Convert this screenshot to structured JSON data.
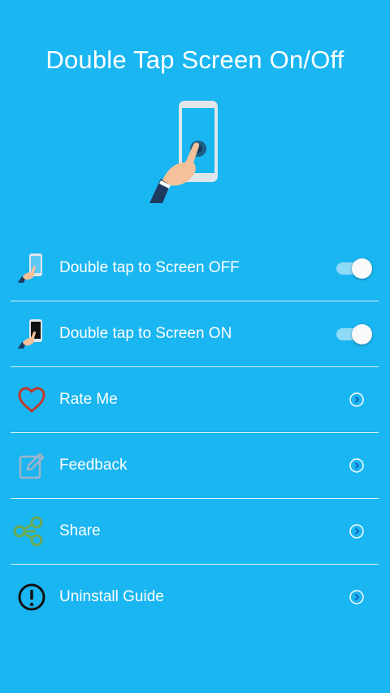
{
  "app": {
    "title": "Double Tap Screen On/Off"
  },
  "menu": {
    "items": [
      {
        "label": "Double tap to Screen OFF",
        "icon": "hand-phone-off-icon",
        "control": "toggle",
        "checked": true
      },
      {
        "label": "Double tap to Screen ON",
        "icon": "hand-phone-on-icon",
        "control": "toggle",
        "checked": true
      },
      {
        "label": "Rate Me",
        "icon": "heart-icon",
        "control": "chevron"
      },
      {
        "label": "Feedback",
        "icon": "edit-icon",
        "control": "chevron"
      },
      {
        "label": "Share",
        "icon": "share-icon",
        "control": "chevron"
      },
      {
        "label": "Uninstall Guide",
        "icon": "alert-circle-icon",
        "control": "chevron"
      }
    ]
  },
  "colors": {
    "background": "#1ab6f2",
    "text": "#ffffff",
    "toggle_track": "#8edbf8",
    "toggle_knob": "#fafafa",
    "heart": "#c0392b",
    "share": "#6aa84f",
    "edit": "#9fb3c8"
  }
}
